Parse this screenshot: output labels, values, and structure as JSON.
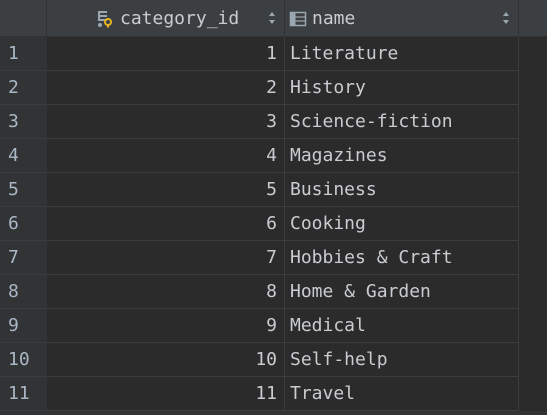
{
  "columns": [
    {
      "key": "category_id",
      "label": "category_id",
      "icon": "key-column-icon"
    },
    {
      "key": "name",
      "label": "name",
      "icon": "column-icon"
    }
  ],
  "rows": [
    {
      "num": "1",
      "category_id": "1",
      "name": "Literature"
    },
    {
      "num": "2",
      "category_id": "2",
      "name": "History"
    },
    {
      "num": "3",
      "category_id": "3",
      "name": "Science-fiction"
    },
    {
      "num": "4",
      "category_id": "4",
      "name": "Magazines"
    },
    {
      "num": "5",
      "category_id": "5",
      "name": "Business"
    },
    {
      "num": "6",
      "category_id": "6",
      "name": "Cooking"
    },
    {
      "num": "7",
      "category_id": "7",
      "name": "Hobbies & Craft"
    },
    {
      "num": "8",
      "category_id": "8",
      "name": "Home & Garden"
    },
    {
      "num": "9",
      "category_id": "9",
      "name": "Medical"
    },
    {
      "num": "10",
      "category_id": "10",
      "name": "Self-help"
    },
    {
      "num": "11",
      "category_id": "11",
      "name": "Travel"
    }
  ],
  "colors": {
    "background": "#2b2b2b",
    "header": "#3c3f41",
    "text": "#c9ccd1",
    "icon": "#9aa7b0"
  }
}
